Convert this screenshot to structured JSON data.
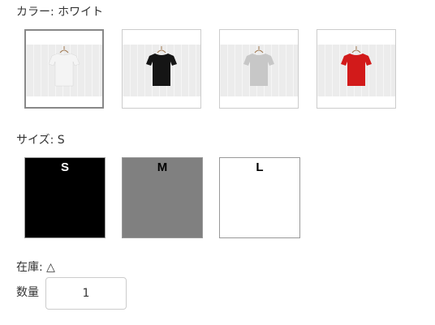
{
  "color_selector": {
    "label": "カラー: ホワイト",
    "options": [
      {
        "name": "ホワイト",
        "shirt_color": "#f4f4f4",
        "selected": true
      },
      {
        "name": "ブラック",
        "shirt_color": "#151515",
        "selected": false
      },
      {
        "name": "グレー",
        "shirt_color": "#c7c7c7",
        "selected": false
      },
      {
        "name": "レッド",
        "shirt_color": "#d21a1a",
        "selected": false
      }
    ]
  },
  "size_selector": {
    "label": "サイズ: S",
    "options": [
      {
        "label": "S",
        "background": "#000000",
        "text_color": "#ffffff",
        "selected": true
      },
      {
        "label": "M",
        "background": "#808080",
        "text_color": "#000000",
        "selected": false
      },
      {
        "label": "L",
        "background": "#ffffff",
        "text_color": "#000000",
        "selected": false
      }
    ]
  },
  "stock": {
    "label": "在庫: △"
  },
  "quantity": {
    "label": "数量",
    "value": "1"
  }
}
